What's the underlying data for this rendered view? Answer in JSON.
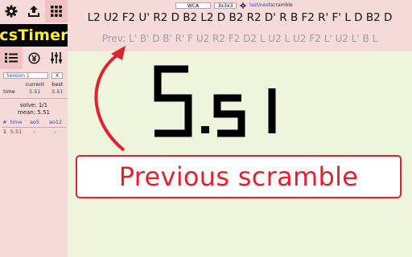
{
  "app": {
    "logo_text": "csTimer"
  },
  "sidebar": {
    "buttons": [
      {
        "name": "settings-icon"
      },
      {
        "name": "export-icon"
      },
      {
        "name": "grid-icon"
      },
      {
        "name": "list-icon"
      },
      {
        "name": "donate-icon"
      },
      {
        "name": "sliders-icon"
      }
    ],
    "session": {
      "label": "Session",
      "value": "1",
      "close": "X"
    },
    "summary": {
      "current_header": "current",
      "best_header": "best",
      "row_label": "time",
      "current": "5.51",
      "best": "5.51"
    },
    "solve_line": "solve: 1/1",
    "mean_line": "mean: 5.51",
    "times_table": {
      "headers": [
        "#",
        "time",
        "ao5",
        "ao12"
      ],
      "rows": [
        {
          "idx": "1",
          "time": "5.51",
          "ao5": "-",
          "ao12": "-"
        }
      ]
    }
  },
  "toolbar": {
    "event_type": "WCA",
    "puzzle": "3x3x3",
    "last_next_link": "last/next",
    "scramble_label": " scramble"
  },
  "scramble": {
    "current": "L2 U2 F2 U' R2 D B2 L2 D B2 R2 D' R B F2 R' F' L D B2 D",
    "previous": "Prev: L' B' D B' R' F U2 R2 F2 D2 L U2 L U2 F2 L' U2 L' B L"
  },
  "timer": {
    "display": "5.51"
  },
  "annotation": {
    "text": "Previous scramble",
    "color": "#e0222c"
  },
  "colors": {
    "logo_bg": "#000000",
    "logo_text": "#ffef2a",
    "panel": "#f6dada",
    "main_bg": "#eef5dc",
    "accent_blue": "#2a48c8",
    "best_red": "#d01818"
  }
}
